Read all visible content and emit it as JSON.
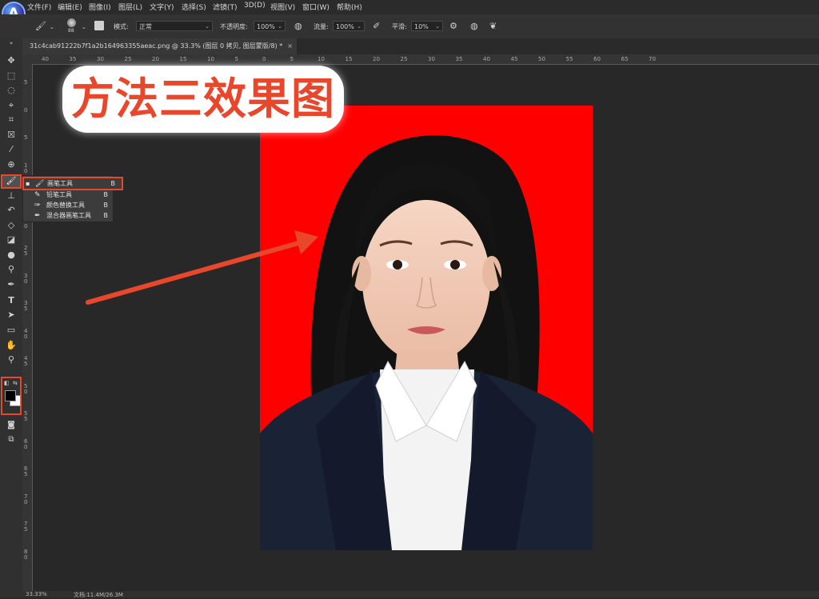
{
  "app": {
    "logo_letter": "A"
  },
  "menu": [
    "文件(F)",
    "编辑(E)",
    "图像(I)",
    "图层(L)",
    "文字(Y)",
    "选择(S)",
    "滤镜(T)",
    "3D(D)",
    "视图(V)",
    "窗口(W)",
    "帮助(H)"
  ],
  "options": {
    "brush_size": "88",
    "mode_label": "模式:",
    "mode_value": "正常",
    "opacity_label": "不透明度:",
    "opacity_value": "100%",
    "flow_label": "流量:",
    "flow_value": "100%",
    "smooth_label": "平滑:",
    "smooth_value": "10%"
  },
  "document": {
    "tab_title": "31c4cab91222b7f1a2b164963355aeac.png @ 33.3% (图层 0 拷贝, 图层蒙版/8) *",
    "close_glyph": "×"
  },
  "ruler_h": [
    "40",
    "35",
    "30",
    "25",
    "20",
    "15",
    "10",
    "5",
    "0",
    "5",
    "10",
    "15",
    "20",
    "25",
    "30",
    "35",
    "40",
    "45",
    "50",
    "55",
    "60",
    "65",
    "70"
  ],
  "ruler_v": [
    "5",
    "0",
    "5",
    "1 0",
    "1 5",
    "2 0",
    "2 5",
    "3 0",
    "3 5",
    "4 0",
    "4 5",
    "5 0",
    "5 5",
    "6 0",
    "6 5",
    "7 0",
    "7 5",
    "8 0"
  ],
  "flyout": [
    {
      "name": "画笔工具",
      "shortcut": "B",
      "icon": "brush-icon",
      "active": true
    },
    {
      "name": "铅笔工具",
      "shortcut": "B",
      "icon": "pencil-icon",
      "active": false
    },
    {
      "name": "颜色替换工具",
      "shortcut": "B",
      "icon": "color-replace-icon",
      "active": false
    },
    {
      "name": "混合器画笔工具",
      "shortcut": "B",
      "icon": "mixer-brush-icon",
      "active": false
    }
  ],
  "annotation": {
    "title": "方法三效果图"
  },
  "status": {
    "zoom": "33.33%",
    "doc": "文档:11.4M/26.3M"
  },
  "colors": {
    "accent": "#e8472b",
    "canvas_bg": "#ff0000",
    "app_bg": "#282828",
    "suit": "#1a2236"
  }
}
